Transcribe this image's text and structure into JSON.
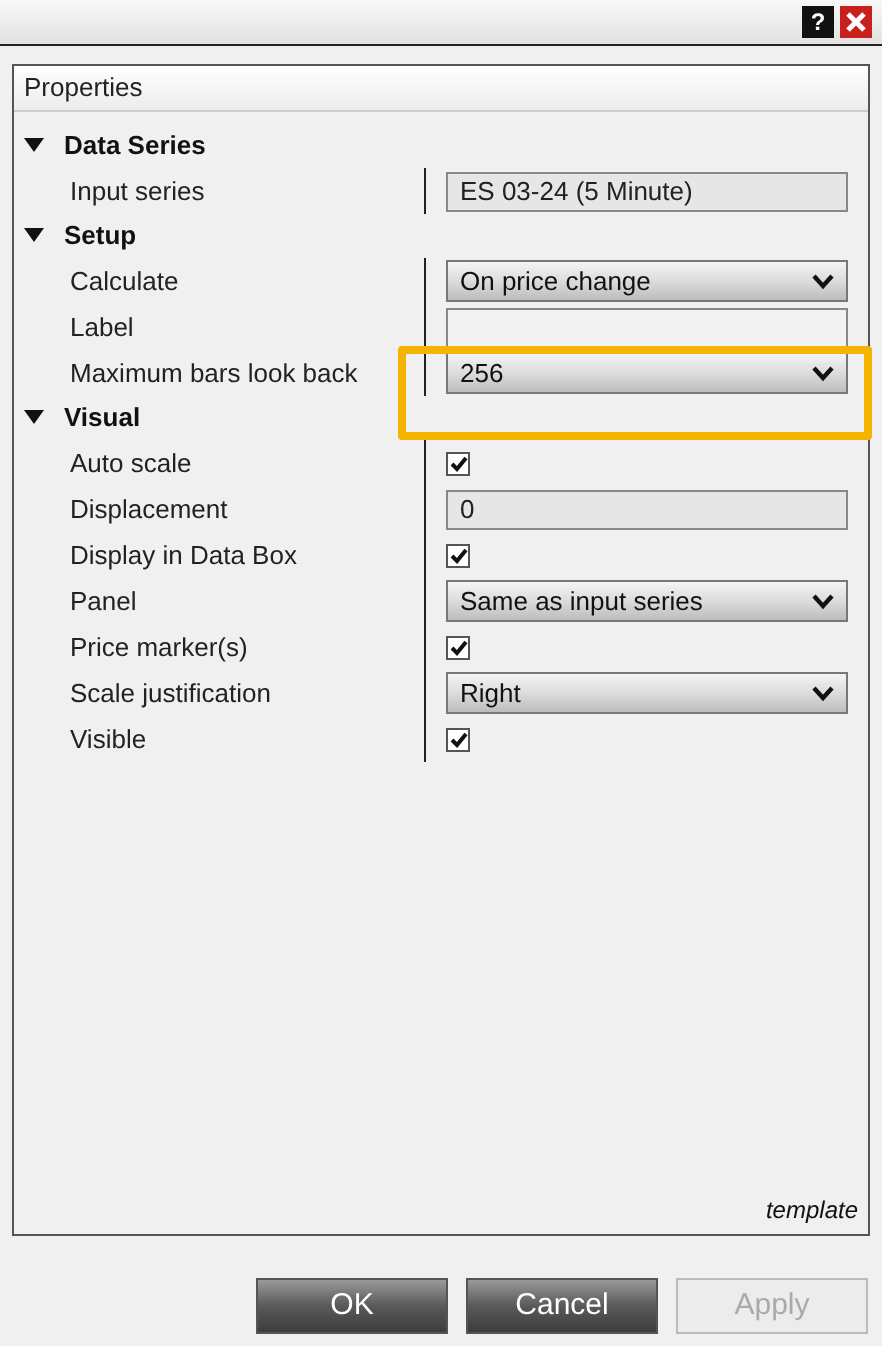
{
  "window": {
    "help": "?"
  },
  "panel": {
    "title": "Properties",
    "footer": "template"
  },
  "categories": [
    {
      "label": "Data Series",
      "expanded": true,
      "children": [
        {
          "kind": "readonly",
          "label": "Input series",
          "value": "ES 03-24 (5 Minute)"
        }
      ]
    },
    {
      "label": "Setup",
      "expanded": true,
      "children": [
        {
          "kind": "select",
          "label": "Calculate",
          "value": "On price change"
        },
        {
          "kind": "text",
          "label": "Label"
        },
        {
          "kind": "select",
          "label": "Maximum bars look back",
          "value": "256",
          "highlighted": true
        }
      ]
    },
    {
      "label": "Visual",
      "expanded": true,
      "children": [
        {
          "kind": "checkbox",
          "label": "Auto scale",
          "checked": true
        },
        {
          "kind": "readonly",
          "label": "Displacement",
          "value": "0"
        },
        {
          "kind": "checkbox",
          "label": "Display in Data Box",
          "checked": true
        },
        {
          "kind": "select",
          "label": "Panel",
          "value": "Same as input series"
        },
        {
          "kind": "checkbox",
          "label": "Price marker(s)",
          "checked": true
        },
        {
          "kind": "select",
          "label": "Scale justification",
          "value": "Right"
        },
        {
          "kind": "checkbox",
          "label": "Visible",
          "checked": true
        }
      ]
    }
  ],
  "buttons": [
    {
      "label": "OK",
      "disabled": false
    },
    {
      "label": "Cancel",
      "disabled": false
    },
    {
      "label": "Apply",
      "disabled": true
    }
  ]
}
